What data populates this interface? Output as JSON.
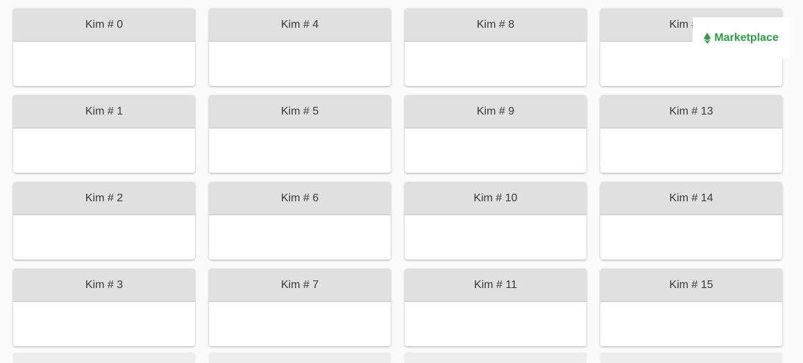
{
  "cards": [
    {
      "title": "Kim # 0"
    },
    {
      "title": "Kim # 4"
    },
    {
      "title": "Kim # 8"
    },
    {
      "title": "Kim # 12"
    },
    {
      "title": "Kim # 1"
    },
    {
      "title": "Kim # 5"
    },
    {
      "title": "Kim # 9"
    },
    {
      "title": "Kim # 13"
    },
    {
      "title": "Kim # 2"
    },
    {
      "title": "Kim # 6"
    },
    {
      "title": "Kim # 10"
    },
    {
      "title": "Kim # 14"
    },
    {
      "title": "Kim # 3"
    },
    {
      "title": "Kim # 7"
    },
    {
      "title": "Kim # 11"
    },
    {
      "title": "Kim # 15"
    }
  ],
  "marketplace": {
    "label": "Marketplace",
    "icon": "ethereum-icon",
    "color": "#2e9e46"
  }
}
